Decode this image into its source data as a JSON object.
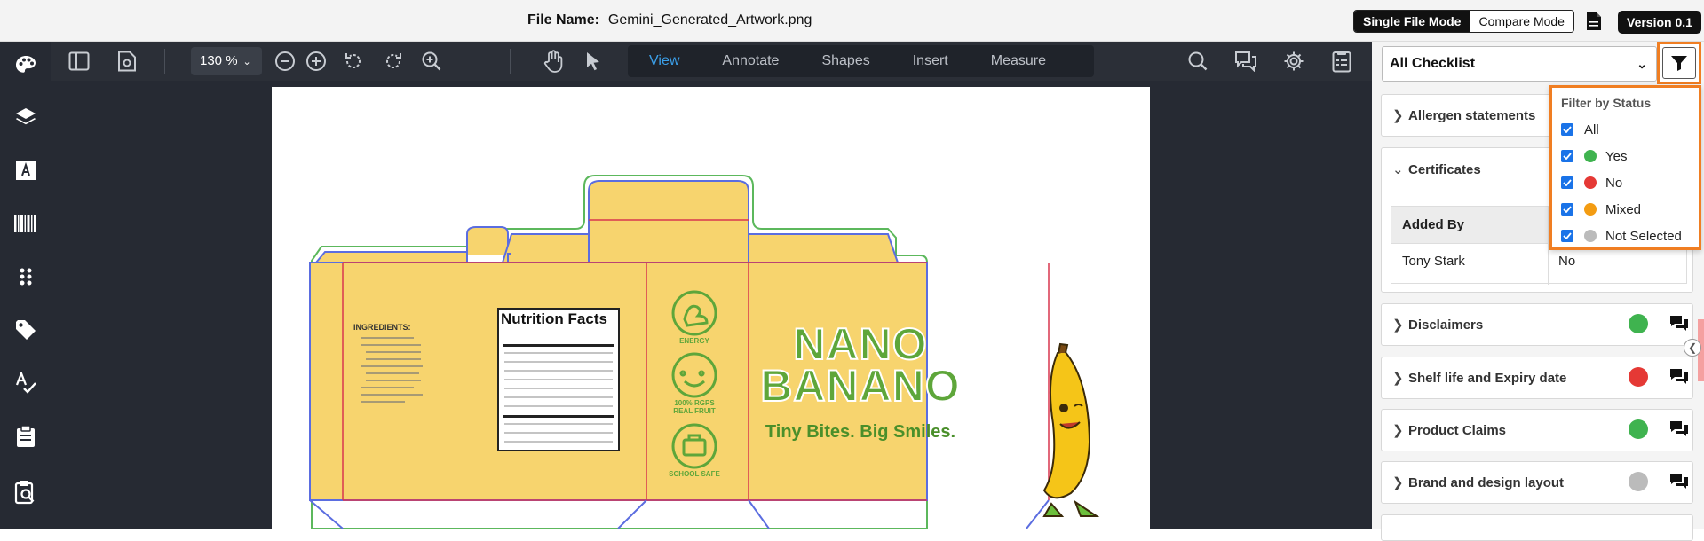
{
  "header": {
    "file_label": "File Name:",
    "file_name": "Gemini_Generated_Artwork.png",
    "mode_single": "Single File Mode",
    "mode_compare": "Compare Mode",
    "version": "Version 0.1"
  },
  "toolbar": {
    "zoom": "130 %",
    "tabs": [
      "View",
      "Annotate",
      "Shapes",
      "Insert",
      "Measure"
    ],
    "active_tab": "View"
  },
  "artwork": {
    "ingredients_title": "INGREDIENTS:",
    "nutrition_title": "Nutrition Facts",
    "icon_labels": [
      "ENERGY",
      "100% RGPS REAL FRUIT",
      "SCHOOL SAFE"
    ],
    "brand_line1": "NANO",
    "brand_line2": "BANANO",
    "tagline": "Tiny Bites. Big Smiles."
  },
  "panel": {
    "checklist_select": "All Checklist",
    "sections": [
      {
        "label": "Allergen statements",
        "status": ""
      },
      {
        "label": "Certificates",
        "status": "expanded"
      },
      {
        "label": "Disclaimers",
        "status": "green"
      },
      {
        "label": "Shelf life and Expiry date",
        "status": "red"
      },
      {
        "label": "Product Claims",
        "status": "green"
      },
      {
        "label": "Brand and design layout",
        "status": "grey"
      }
    ],
    "table": {
      "header": "Added By",
      "row_name": "Tony Stark",
      "row_value": "No"
    },
    "filter": {
      "title": "Filter by Status",
      "options": [
        {
          "label": "All",
          "color": ""
        },
        {
          "label": "Yes",
          "color": "#3fb34f"
        },
        {
          "label": "No",
          "color": "#e53935"
        },
        {
          "label": "Mixed",
          "color": "#f39c12"
        },
        {
          "label": "Not Selected",
          "color": "#bbbbbb"
        }
      ]
    }
  },
  "colors": {
    "accent": "#f07e22",
    "active_tab": "#3b9fe8",
    "green": "#3fb34f",
    "red": "#e53935",
    "grey": "#bbbbbb"
  }
}
